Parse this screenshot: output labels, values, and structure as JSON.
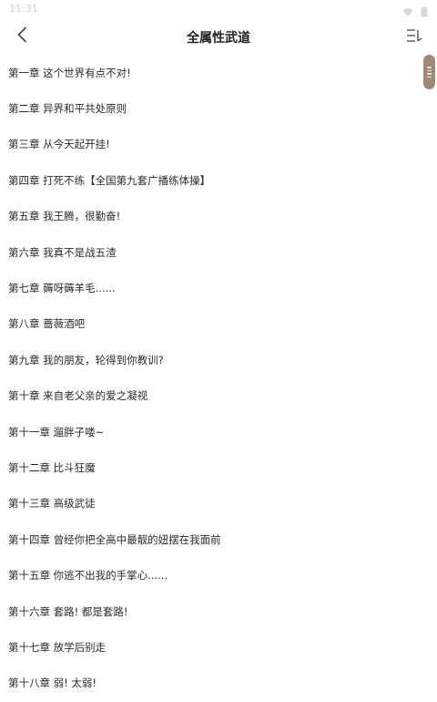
{
  "status_bar": {
    "time": "11:31",
    "icons": [
      "wifi-icon",
      "battery-icon"
    ]
  },
  "header": {
    "title": "全属性武道",
    "back_icon": "chevron-left-icon",
    "sort_icon": "sort-lines-icon"
  },
  "chapters": [
    "第一章 这个世界有点不对!",
    "第二章 异界和平共处原则",
    "第三章 从今天起开挂!",
    "第四章 打死不练【全国第九套广播练体操】",
    "第五章 我王腾，很勤奋!",
    "第六章 我真不是战五渣",
    "第七章 薅呀薅羊毛......",
    "第八章 蔷薇酒吧",
    "第九章 我的朋友，轮得到你教训?",
    "第十章 来自老父亲的爱之凝视",
    "第十一章 遛胖子喽~",
    "第十二章 比斗狂魔",
    "第十三章 高级武徒",
    "第十四章 曾经你把全高中最靓的妞摆在我面前",
    "第十五章 你逃不出我的手掌心......",
    "第十六章 套路! 都是套路!",
    "第十七章 放学后别走",
    "第十八章 弱! 太弱!"
  ],
  "colors": {
    "scroll_handle": "#a08979",
    "text": "#2a2a2a"
  }
}
